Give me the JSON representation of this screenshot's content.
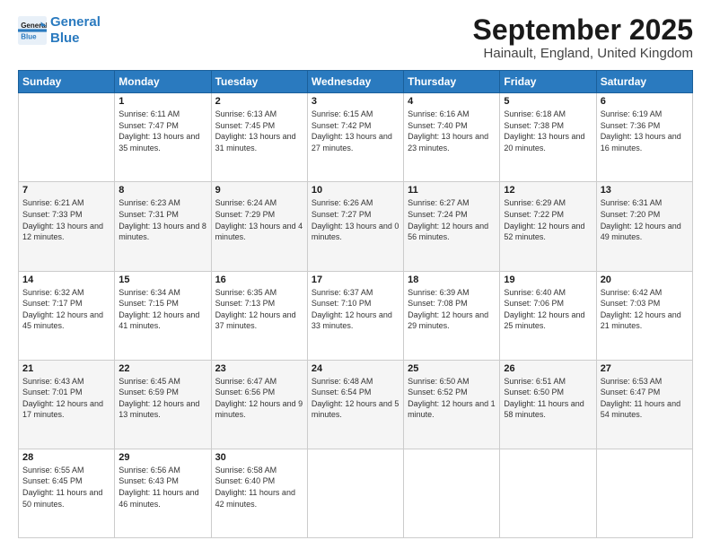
{
  "header": {
    "logo_line1": "General",
    "logo_line2": "Blue",
    "month_title": "September 2025",
    "location": "Hainault, England, United Kingdom"
  },
  "weekdays": [
    "Sunday",
    "Monday",
    "Tuesday",
    "Wednesday",
    "Thursday",
    "Friday",
    "Saturday"
  ],
  "weeks": [
    [
      {
        "day": "",
        "sunrise": "",
        "sunset": "",
        "daylight": ""
      },
      {
        "day": "1",
        "sunrise": "Sunrise: 6:11 AM",
        "sunset": "Sunset: 7:47 PM",
        "daylight": "Daylight: 13 hours and 35 minutes."
      },
      {
        "day": "2",
        "sunrise": "Sunrise: 6:13 AM",
        "sunset": "Sunset: 7:45 PM",
        "daylight": "Daylight: 13 hours and 31 minutes."
      },
      {
        "day": "3",
        "sunrise": "Sunrise: 6:15 AM",
        "sunset": "Sunset: 7:42 PM",
        "daylight": "Daylight: 13 hours and 27 minutes."
      },
      {
        "day": "4",
        "sunrise": "Sunrise: 6:16 AM",
        "sunset": "Sunset: 7:40 PM",
        "daylight": "Daylight: 13 hours and 23 minutes."
      },
      {
        "day": "5",
        "sunrise": "Sunrise: 6:18 AM",
        "sunset": "Sunset: 7:38 PM",
        "daylight": "Daylight: 13 hours and 20 minutes."
      },
      {
        "day": "6",
        "sunrise": "Sunrise: 6:19 AM",
        "sunset": "Sunset: 7:36 PM",
        "daylight": "Daylight: 13 hours and 16 minutes."
      }
    ],
    [
      {
        "day": "7",
        "sunrise": "Sunrise: 6:21 AM",
        "sunset": "Sunset: 7:33 PM",
        "daylight": "Daylight: 13 hours and 12 minutes."
      },
      {
        "day": "8",
        "sunrise": "Sunrise: 6:23 AM",
        "sunset": "Sunset: 7:31 PM",
        "daylight": "Daylight: 13 hours and 8 minutes."
      },
      {
        "day": "9",
        "sunrise": "Sunrise: 6:24 AM",
        "sunset": "Sunset: 7:29 PM",
        "daylight": "Daylight: 13 hours and 4 minutes."
      },
      {
        "day": "10",
        "sunrise": "Sunrise: 6:26 AM",
        "sunset": "Sunset: 7:27 PM",
        "daylight": "Daylight: 13 hours and 0 minutes."
      },
      {
        "day": "11",
        "sunrise": "Sunrise: 6:27 AM",
        "sunset": "Sunset: 7:24 PM",
        "daylight": "Daylight: 12 hours and 56 minutes."
      },
      {
        "day": "12",
        "sunrise": "Sunrise: 6:29 AM",
        "sunset": "Sunset: 7:22 PM",
        "daylight": "Daylight: 12 hours and 52 minutes."
      },
      {
        "day": "13",
        "sunrise": "Sunrise: 6:31 AM",
        "sunset": "Sunset: 7:20 PM",
        "daylight": "Daylight: 12 hours and 49 minutes."
      }
    ],
    [
      {
        "day": "14",
        "sunrise": "Sunrise: 6:32 AM",
        "sunset": "Sunset: 7:17 PM",
        "daylight": "Daylight: 12 hours and 45 minutes."
      },
      {
        "day": "15",
        "sunrise": "Sunrise: 6:34 AM",
        "sunset": "Sunset: 7:15 PM",
        "daylight": "Daylight: 12 hours and 41 minutes."
      },
      {
        "day": "16",
        "sunrise": "Sunrise: 6:35 AM",
        "sunset": "Sunset: 7:13 PM",
        "daylight": "Daylight: 12 hours and 37 minutes."
      },
      {
        "day": "17",
        "sunrise": "Sunrise: 6:37 AM",
        "sunset": "Sunset: 7:10 PM",
        "daylight": "Daylight: 12 hours and 33 minutes."
      },
      {
        "day": "18",
        "sunrise": "Sunrise: 6:39 AM",
        "sunset": "Sunset: 7:08 PM",
        "daylight": "Daylight: 12 hours and 29 minutes."
      },
      {
        "day": "19",
        "sunrise": "Sunrise: 6:40 AM",
        "sunset": "Sunset: 7:06 PM",
        "daylight": "Daylight: 12 hours and 25 minutes."
      },
      {
        "day": "20",
        "sunrise": "Sunrise: 6:42 AM",
        "sunset": "Sunset: 7:03 PM",
        "daylight": "Daylight: 12 hours and 21 minutes."
      }
    ],
    [
      {
        "day": "21",
        "sunrise": "Sunrise: 6:43 AM",
        "sunset": "Sunset: 7:01 PM",
        "daylight": "Daylight: 12 hours and 17 minutes."
      },
      {
        "day": "22",
        "sunrise": "Sunrise: 6:45 AM",
        "sunset": "Sunset: 6:59 PM",
        "daylight": "Daylight: 12 hours and 13 minutes."
      },
      {
        "day": "23",
        "sunrise": "Sunrise: 6:47 AM",
        "sunset": "Sunset: 6:56 PM",
        "daylight": "Daylight: 12 hours and 9 minutes."
      },
      {
        "day": "24",
        "sunrise": "Sunrise: 6:48 AM",
        "sunset": "Sunset: 6:54 PM",
        "daylight": "Daylight: 12 hours and 5 minutes."
      },
      {
        "day": "25",
        "sunrise": "Sunrise: 6:50 AM",
        "sunset": "Sunset: 6:52 PM",
        "daylight": "Daylight: 12 hours and 1 minute."
      },
      {
        "day": "26",
        "sunrise": "Sunrise: 6:51 AM",
        "sunset": "Sunset: 6:50 PM",
        "daylight": "Daylight: 11 hours and 58 minutes."
      },
      {
        "day": "27",
        "sunrise": "Sunrise: 6:53 AM",
        "sunset": "Sunset: 6:47 PM",
        "daylight": "Daylight: 11 hours and 54 minutes."
      }
    ],
    [
      {
        "day": "28",
        "sunrise": "Sunrise: 6:55 AM",
        "sunset": "Sunset: 6:45 PM",
        "daylight": "Daylight: 11 hours and 50 minutes."
      },
      {
        "day": "29",
        "sunrise": "Sunrise: 6:56 AM",
        "sunset": "Sunset: 6:43 PM",
        "daylight": "Daylight: 11 hours and 46 minutes."
      },
      {
        "day": "30",
        "sunrise": "Sunrise: 6:58 AM",
        "sunset": "Sunset: 6:40 PM",
        "daylight": "Daylight: 11 hours and 42 minutes."
      },
      {
        "day": "",
        "sunrise": "",
        "sunset": "",
        "daylight": ""
      },
      {
        "day": "",
        "sunrise": "",
        "sunset": "",
        "daylight": ""
      },
      {
        "day": "",
        "sunrise": "",
        "sunset": "",
        "daylight": ""
      },
      {
        "day": "",
        "sunrise": "",
        "sunset": "",
        "daylight": ""
      }
    ]
  ]
}
